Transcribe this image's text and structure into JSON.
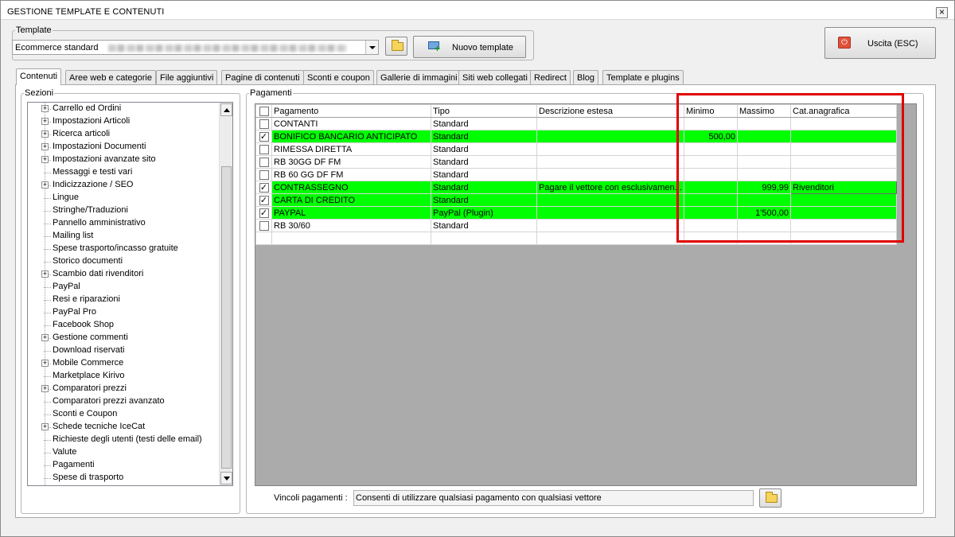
{
  "window": {
    "title": "GESTIONE TEMPLATE E CONTENUTI",
    "close_glyph": "×"
  },
  "template": {
    "group_label": "Template",
    "selected": "Ecommerce standard",
    "new_button": "Nuovo template",
    "exit_button": "Uscita (ESC)"
  },
  "tabs": [
    {
      "label": "Contenuti",
      "active": true
    },
    {
      "label": "Aree web e categorie"
    },
    {
      "label": "File aggiuntivi"
    },
    {
      "label": "Pagine di contenuti"
    },
    {
      "label": "Sconti e coupon"
    },
    {
      "label": "Gallerie di immagini"
    },
    {
      "label": "Siti web collegati"
    },
    {
      "label": "Redirect"
    },
    {
      "label": "Blog"
    },
    {
      "label": "Template e plugins"
    }
  ],
  "sections": {
    "group_label": "Sezioni",
    "items": [
      {
        "label": "Carrello ed Ordini",
        "expandable": true
      },
      {
        "label": "Impostazioni Articoli",
        "expandable": true
      },
      {
        "label": "Ricerca articoli",
        "expandable": true
      },
      {
        "label": "Impostazioni Documenti",
        "expandable": true
      },
      {
        "label": "Impostazioni avanzate sito",
        "expandable": true
      },
      {
        "label": "Messaggi e testi vari",
        "expandable": false
      },
      {
        "label": "Indicizzazione / SEO",
        "expandable": true
      },
      {
        "label": "Lingue",
        "expandable": false
      },
      {
        "label": "Stringhe/Traduzioni",
        "expandable": false
      },
      {
        "label": "Pannello amministrativo",
        "expandable": false
      },
      {
        "label": "Mailing list",
        "expandable": false
      },
      {
        "label": "Spese trasporto/incasso gratuite",
        "expandable": false
      },
      {
        "label": "Storico documenti",
        "expandable": false
      },
      {
        "label": "Scambio dati rivenditori",
        "expandable": true
      },
      {
        "label": "PayPal",
        "expandable": false
      },
      {
        "label": "Resi e riparazioni",
        "expandable": false
      },
      {
        "label": "PayPal Pro",
        "expandable": false
      },
      {
        "label": "Facebook Shop",
        "expandable": false
      },
      {
        "label": "Gestione commenti",
        "expandable": true
      },
      {
        "label": "Download riservati",
        "expandable": false
      },
      {
        "label": "Mobile Commerce",
        "expandable": true
      },
      {
        "label": "Marketplace Kirivo",
        "expandable": false
      },
      {
        "label": "Comparatori prezzi",
        "expandable": true
      },
      {
        "label": "Comparatori prezzi avanzato",
        "expandable": false
      },
      {
        "label": "Sconti e Coupon",
        "expandable": false
      },
      {
        "label": "Schede tecniche IceCat",
        "expandable": true
      },
      {
        "label": "Richieste degli utenti (testi delle email)",
        "expandable": false
      },
      {
        "label": "Valute",
        "expandable": false
      },
      {
        "label": "Pagamenti",
        "expandable": false
      },
      {
        "label": "Spese di trasporto",
        "expandable": false
      }
    ]
  },
  "payments": {
    "group_label": "Pagamenti",
    "columns": [
      "Pagamento",
      "Tipo",
      "Descrizione estesa",
      "Minimo",
      "Massimo",
      "Cat.anagrafica"
    ],
    "rows": [
      {
        "checked": false,
        "name": "CONTANTI",
        "type": "Standard",
        "desc": "",
        "min": "",
        "max": "",
        "cat": ""
      },
      {
        "checked": true,
        "name": "BONIFICO BANCARIO ANTICIPATO",
        "type": "Standard",
        "desc": "",
        "min": "500,00",
        "max": "",
        "cat": ""
      },
      {
        "checked": false,
        "name": "RIMESSA DIRETTA",
        "type": "Standard",
        "desc": "",
        "min": "",
        "max": "",
        "cat": ""
      },
      {
        "checked": false,
        "name": "RB 30GG DF FM",
        "type": "Standard",
        "desc": "",
        "min": "",
        "max": "",
        "cat": ""
      },
      {
        "checked": false,
        "name": "RB 60 GG DF FM",
        "type": "Standard",
        "desc": "",
        "min": "",
        "max": "",
        "cat": ""
      },
      {
        "checked": true,
        "name": "CONTRASSEGNO",
        "type": "Standard",
        "desc": "Pagare il vettore con esclusivamen...",
        "min": "",
        "max": "999,99",
        "cat": "Rivenditori"
      },
      {
        "checked": true,
        "name": "CARTA DI CREDITO",
        "type": "Standard",
        "desc": "",
        "min": "",
        "max": "",
        "cat": ""
      },
      {
        "checked": true,
        "name": "PAYPAL",
        "type": "PayPal (Plugin)",
        "desc": "",
        "min": "",
        "max": "1'500,00",
        "cat": ""
      },
      {
        "checked": false,
        "name": "RB 30/60",
        "type": "Standard",
        "desc": "",
        "min": "",
        "max": "",
        "cat": ""
      }
    ],
    "vincoli_label": "Vincoli pagamenti :",
    "vincoli_value": "Consenti di utilizzare qualsiasi pagamento con qualsiasi vettore"
  },
  "colors": {
    "active_row": "#00ff00",
    "highlight_box": "#e00000",
    "exit_icon": "#e0513b"
  }
}
